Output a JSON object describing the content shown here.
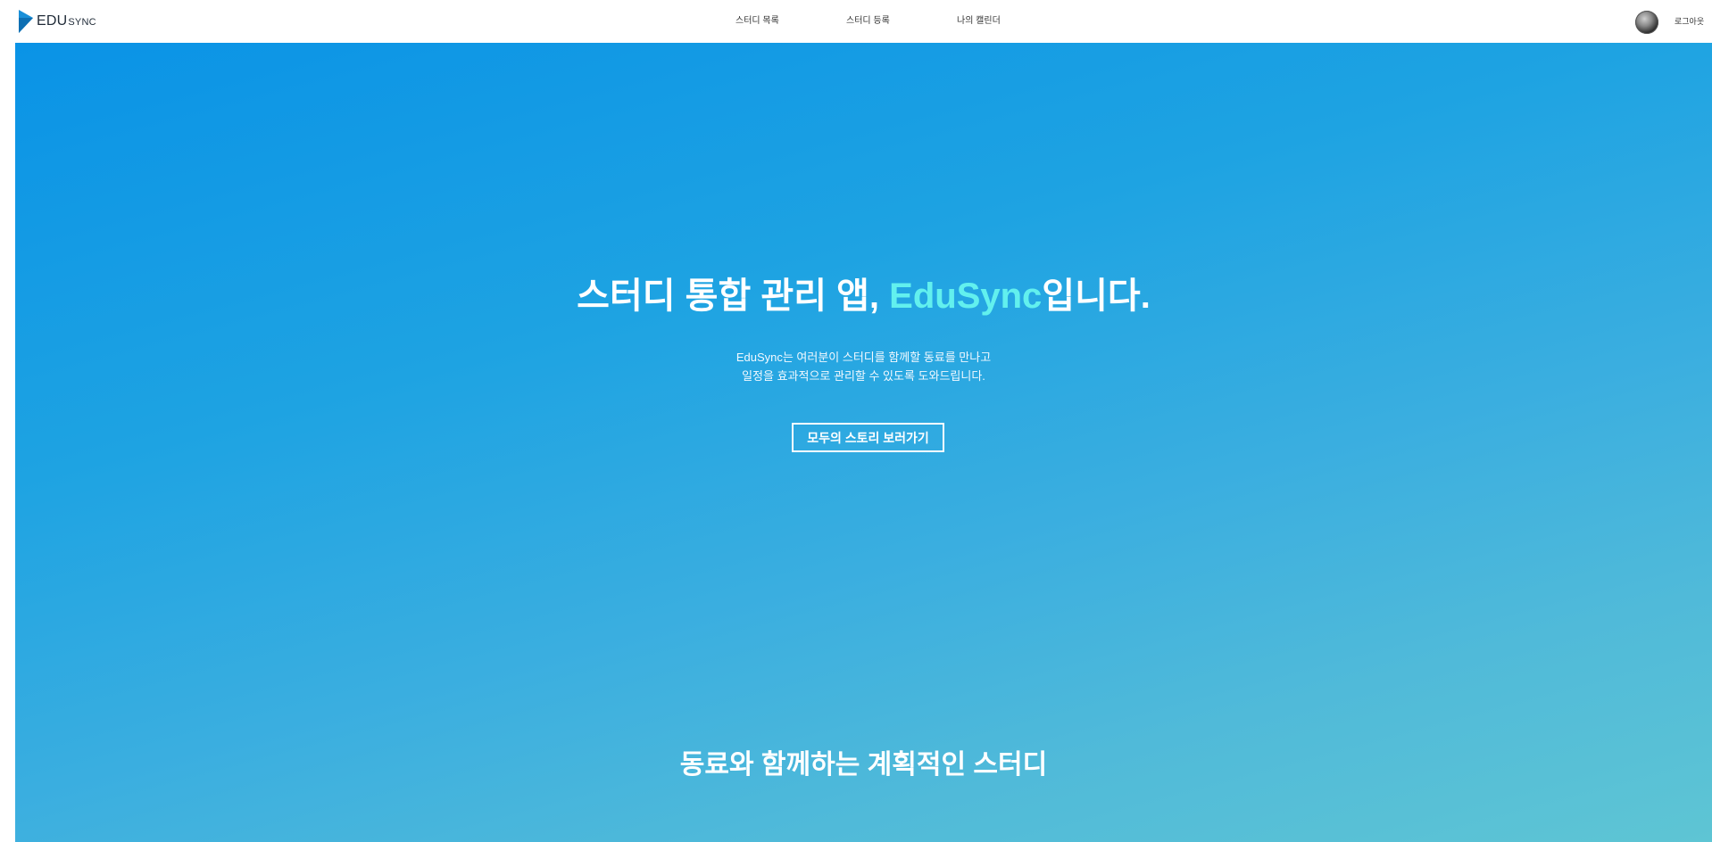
{
  "header": {
    "logo": {
      "main": "EDU",
      "sub": "SYNC"
    },
    "nav": [
      {
        "label": "스터디 목록"
      },
      {
        "label": "스터디 등록"
      },
      {
        "label": "나의 캘린더"
      }
    ],
    "avatar_icon": "user-avatar",
    "logout_label": "로그아웃"
  },
  "hero": {
    "title_prefix": "스터디 통합 관리 앱, ",
    "title_accent": "EduSync",
    "title_suffix": "입니다.",
    "description_line1": "EduSync는 여러분이 스터디를 함께할 동료를 만나고",
    "description_line2": "일정을 효과적으로 관리할 수 있도록 도와드립니다.",
    "cta_label": "모두의 스토리 보러가기",
    "next_section_title": "동료와 함께하는 계획적인 스터디"
  },
  "colors": {
    "accent": "#62f0ee",
    "gradient_start": "#0a93e6",
    "gradient_end": "#5ec5d4",
    "logo_blue": "#1a8fd8"
  }
}
